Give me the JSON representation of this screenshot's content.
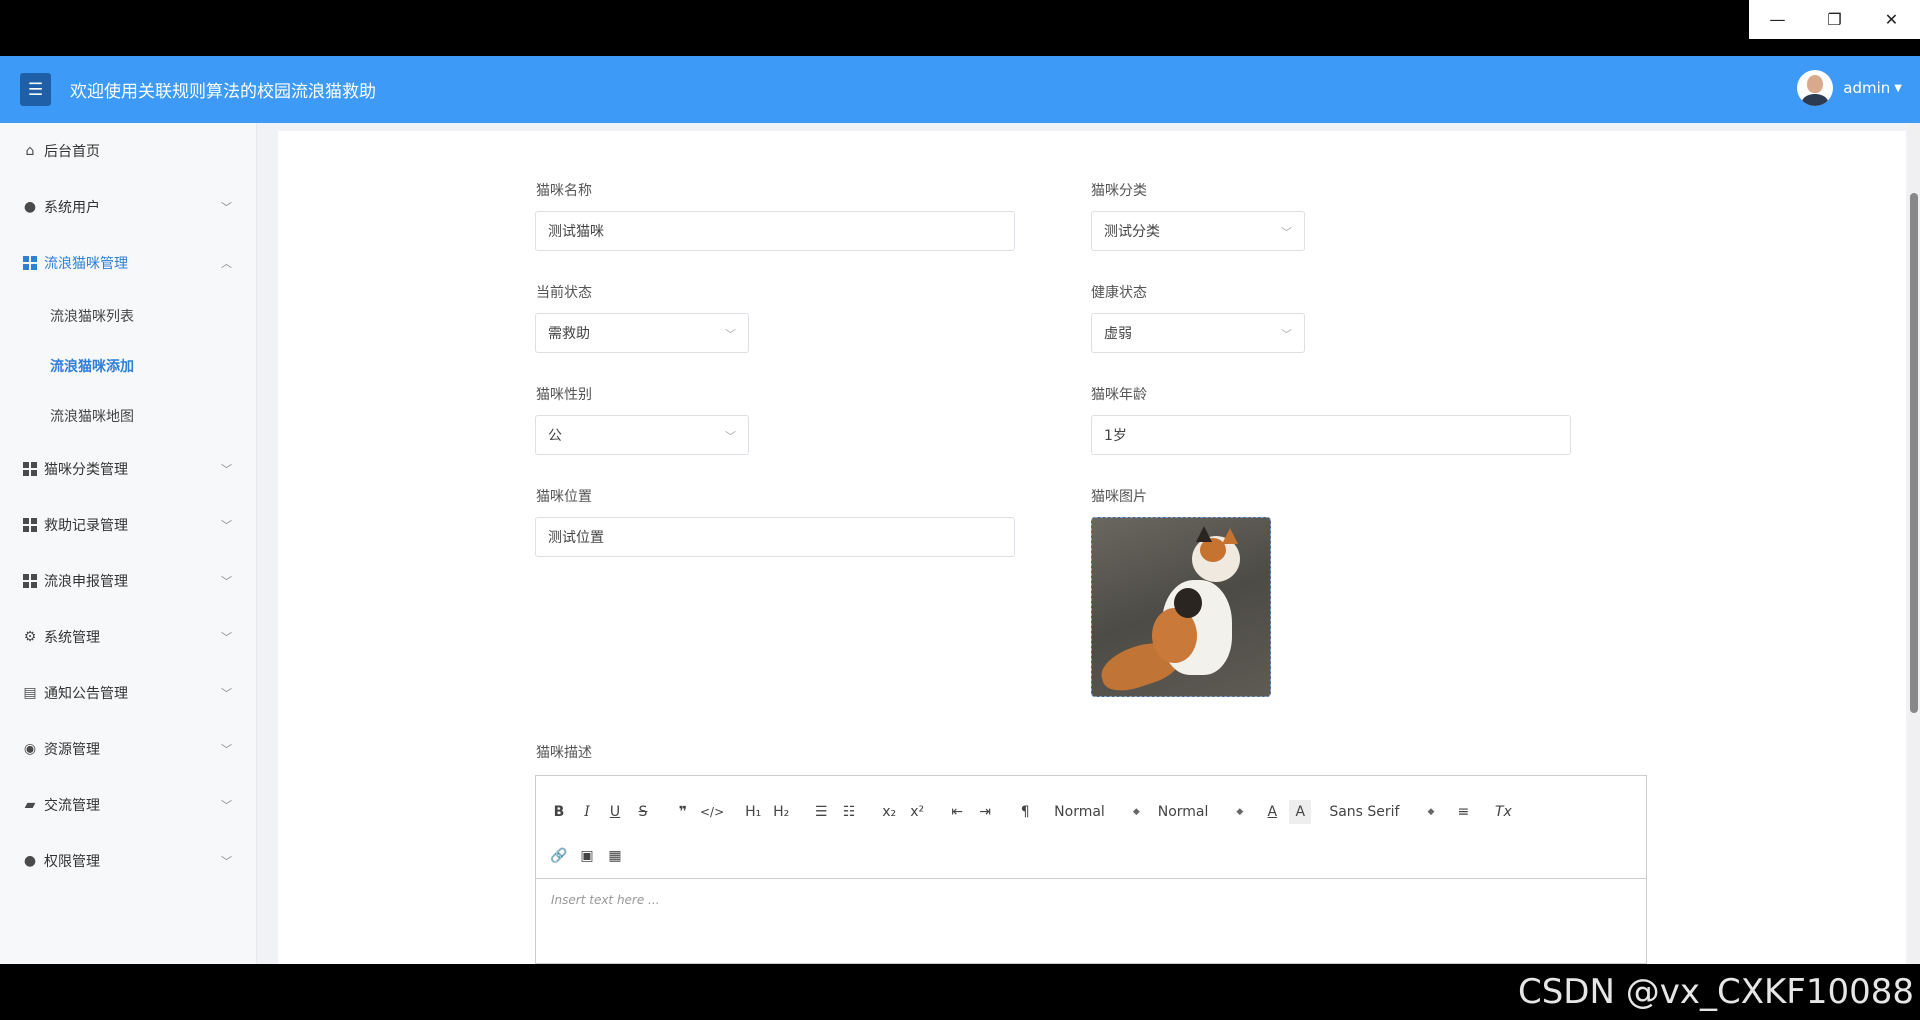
{
  "window": {
    "minimize": "—",
    "restore": "❐",
    "close": "✕"
  },
  "header": {
    "title": "欢迎使用关联规则算法的校园流浪猫救助",
    "user": "admin"
  },
  "sidebar": {
    "items": [
      {
        "label": "后台首页",
        "icon": "home-icon"
      },
      {
        "label": "系统用户",
        "icon": "user-icon"
      },
      {
        "label": "流浪猫咪管理",
        "icon": "grid-icon"
      },
      {
        "label": "猫咪分类管理",
        "icon": "grid-icon"
      },
      {
        "label": "救助记录管理",
        "icon": "grid-icon"
      },
      {
        "label": "流浪申报管理",
        "icon": "grid-icon"
      },
      {
        "label": "系统管理",
        "icon": "gear-icon"
      },
      {
        "label": "通知公告管理",
        "icon": "document-icon"
      },
      {
        "label": "资源管理",
        "icon": "compass-icon"
      },
      {
        "label": "交流管理",
        "icon": "chat-icon"
      },
      {
        "label": "权限管理",
        "icon": "user-icon"
      }
    ],
    "sub_items": [
      {
        "label": "流浪猫咪列表"
      },
      {
        "label": "流浪猫咪添加"
      },
      {
        "label": "流浪猫咪地图"
      }
    ]
  },
  "form": {
    "name_label": "猫咪名称",
    "name_value": "测试猫咪",
    "category_label": "猫咪分类",
    "category_value": "测试分类",
    "status_label": "当前状态",
    "status_value": "需救助",
    "health_label": "健康状态",
    "health_value": "虚弱",
    "gender_label": "猫咪性别",
    "gender_value": "公",
    "age_label": "猫咪年龄",
    "age_value": "1岁",
    "location_label": "猫咪位置",
    "location_value": "测试位置",
    "image_label": "猫咪图片",
    "description_label": "猫咪描述"
  },
  "editor": {
    "font_size": "Normal",
    "heading": "Normal",
    "font_family": "Sans Serif",
    "placeholder": "Insert text here ..."
  },
  "watermark": "CSDN @vx_CXKF10088"
}
